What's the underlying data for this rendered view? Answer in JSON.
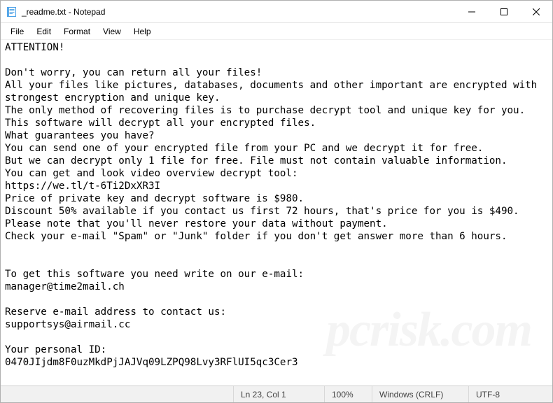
{
  "titlebar": {
    "title": "_readme.txt - Notepad"
  },
  "menubar": {
    "file": "File",
    "edit": "Edit",
    "format": "Format",
    "view": "View",
    "help": "Help"
  },
  "content": {
    "text": "ATTENTION!\n\nDon't worry, you can return all your files!\nAll your files like pictures, databases, documents and other important are encrypted with strongest encryption and unique key.\nThe only method of recovering files is to purchase decrypt tool and unique key for you.\nThis software will decrypt all your encrypted files.\nWhat guarantees you have?\nYou can send one of your encrypted file from your PC and we decrypt it for free.\nBut we can decrypt only 1 file for free. File must not contain valuable information.\nYou can get and look video overview decrypt tool:\nhttps://we.tl/t-6Ti2DxXR3I\nPrice of private key and decrypt software is $980.\nDiscount 50% available if you contact us first 72 hours, that's price for you is $490.\nPlease note that you'll never restore your data without payment.\nCheck your e-mail \"Spam\" or \"Junk\" folder if you don't get answer more than 6 hours.\n\n\nTo get this software you need write on our e-mail:\nmanager@time2mail.ch\n\nReserve e-mail address to contact us:\nsupportsys@airmail.cc\n\nYour personal ID:\n0470JIjdm8F0uzMkdPjJAJVq09LZPQ98Lvy3RFlUI5qc3Cer3"
  },
  "statusbar": {
    "position": "Ln 23, Col 1",
    "zoom": "100%",
    "eol": "Windows (CRLF)",
    "encoding": "UTF-8"
  },
  "watermark": "pcrisk.com"
}
